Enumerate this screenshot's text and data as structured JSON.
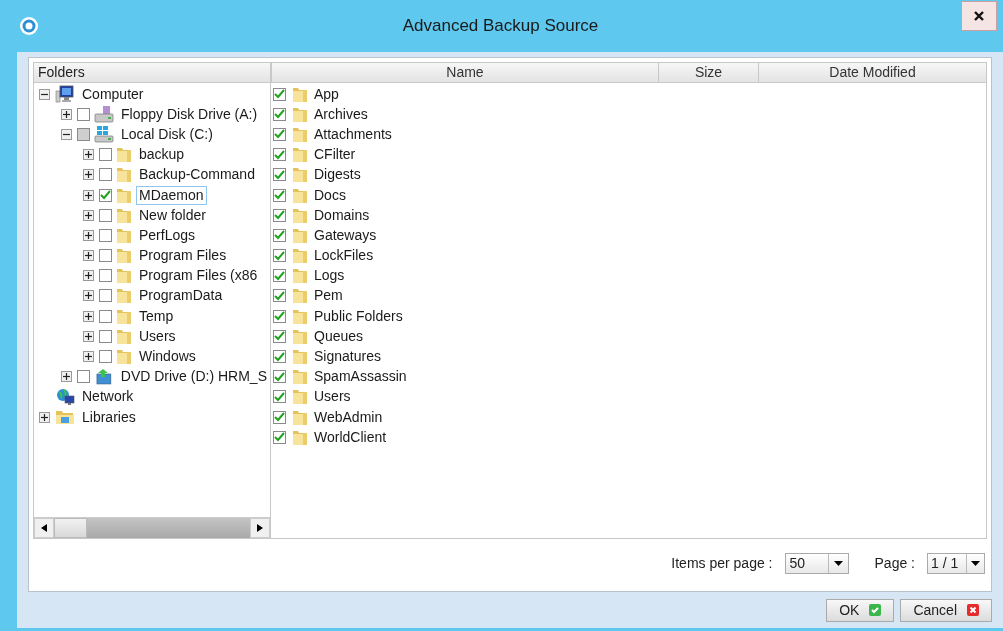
{
  "window": {
    "title": "Advanced Backup Source"
  },
  "folders": {
    "header": "Folders",
    "tree": [
      {
        "label": "Computer",
        "kind": "computer",
        "expanded": true,
        "selected": false,
        "children": [
          {
            "label": "Floppy Disk Drive (A:)",
            "kind": "floppy",
            "expanded": false,
            "checked": false,
            "partial": false,
            "selected": false
          },
          {
            "label": "Local Disk (C:)",
            "kind": "disk",
            "expanded": true,
            "checked": false,
            "partial": true,
            "selected": false,
            "children": [
              {
                "label": "backup",
                "kind": "folder",
                "expanded": false,
                "checked": false,
                "partial": false,
                "selected": false
              },
              {
                "label": "Backup-Command",
                "kind": "folder",
                "expanded": false,
                "checked": false,
                "partial": false,
                "selected": false
              },
              {
                "label": "MDaemon",
                "kind": "folder",
                "expanded": false,
                "checked": true,
                "partial": false,
                "selected": true
              },
              {
                "label": "New folder",
                "kind": "folder",
                "expanded": false,
                "checked": false,
                "partial": false,
                "selected": false
              },
              {
                "label": "PerfLogs",
                "kind": "folder",
                "expanded": false,
                "checked": false,
                "partial": false,
                "selected": false
              },
              {
                "label": "Program Files",
                "kind": "folder",
                "expanded": false,
                "checked": false,
                "partial": false,
                "selected": false
              },
              {
                "label": "Program Files (x86",
                "kind": "folder",
                "expanded": false,
                "checked": false,
                "partial": false,
                "selected": false
              },
              {
                "label": "ProgramData",
                "kind": "folder",
                "expanded": false,
                "checked": false,
                "partial": false,
                "selected": false
              },
              {
                "label": "Temp",
                "kind": "folder",
                "expanded": false,
                "checked": false,
                "partial": false,
                "selected": false
              },
              {
                "label": "Users",
                "kind": "folder",
                "expanded": false,
                "checked": false,
                "partial": false,
                "selected": false
              },
              {
                "label": "Windows",
                "kind": "folder",
                "expanded": false,
                "checked": false,
                "partial": false,
                "selected": false
              }
            ]
          },
          {
            "label": "DVD Drive (D:) HRM_S",
            "kind": "dvd",
            "expanded": false,
            "checked": false,
            "partial": false,
            "selected": false
          }
        ]
      },
      {
        "label": "Network",
        "kind": "network",
        "selected": false
      },
      {
        "label": "Libraries",
        "kind": "libraries",
        "expanded": false,
        "selected": false
      }
    ]
  },
  "table": {
    "columns": [
      "Name",
      "Size",
      "Date Modified"
    ],
    "rows": [
      {
        "name": "App",
        "checked": true
      },
      {
        "name": "Archives",
        "checked": true
      },
      {
        "name": "Attachments",
        "checked": true
      },
      {
        "name": "CFilter",
        "checked": true
      },
      {
        "name": "Digests",
        "checked": true
      },
      {
        "name": "Docs",
        "checked": true
      },
      {
        "name": "Domains",
        "checked": true
      },
      {
        "name": "Gateways",
        "checked": true
      },
      {
        "name": "LockFiles",
        "checked": true
      },
      {
        "name": "Logs",
        "checked": true
      },
      {
        "name": "Pem",
        "checked": true
      },
      {
        "name": "Public Folders",
        "checked": true
      },
      {
        "name": "Queues",
        "checked": true
      },
      {
        "name": "Signatures",
        "checked": true
      },
      {
        "name": "SpamAssassin",
        "checked": true
      },
      {
        "name": "Users",
        "checked": true
      },
      {
        "name": "WebAdmin",
        "checked": true
      },
      {
        "name": "WorldClient",
        "checked": true
      }
    ]
  },
  "pagination": {
    "items_per_page_label": "Items per page :",
    "items_per_page": "50",
    "page_label": "Page :",
    "page": "1 / 1"
  },
  "buttons": [
    {
      "label": "OK",
      "kind": "ok"
    },
    {
      "label": "Cancel",
      "kind": "cancel"
    }
  ]
}
